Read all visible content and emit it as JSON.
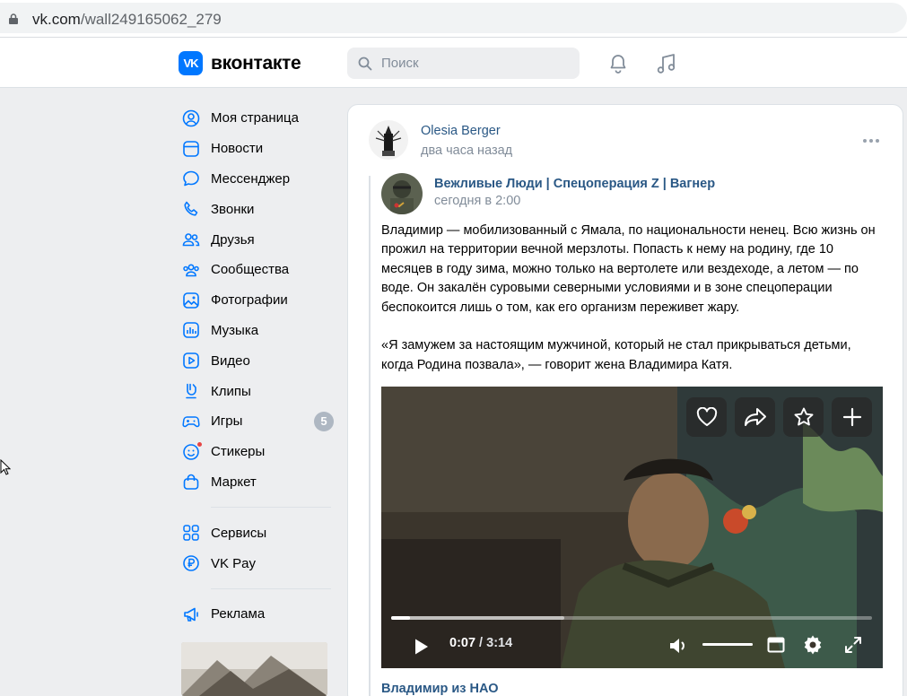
{
  "browser": {
    "url_domain": "vk.com",
    "url_path": "/wall249165062_279"
  },
  "header": {
    "logo_mark": "VK",
    "logo_text": "вконтакте",
    "search_placeholder": "Поиск"
  },
  "sidebar": {
    "items": [
      {
        "label": "Моя страница",
        "icon": "user-circle-icon"
      },
      {
        "label": "Новости",
        "icon": "news-icon"
      },
      {
        "label": "Мессенджер",
        "icon": "message-icon"
      },
      {
        "label": "Звонки",
        "icon": "phone-icon"
      },
      {
        "label": "Друзья",
        "icon": "friends-icon"
      },
      {
        "label": "Сообщества",
        "icon": "communities-icon"
      },
      {
        "label": "Фотографии",
        "icon": "photo-icon"
      },
      {
        "label": "Музыка",
        "icon": "music-icon"
      },
      {
        "label": "Видео",
        "icon": "video-icon"
      },
      {
        "label": "Клипы",
        "icon": "clips-icon"
      },
      {
        "label": "Игры",
        "icon": "gamepad-icon",
        "badge": "5"
      },
      {
        "label": "Стикеры",
        "icon": "sticker-icon"
      },
      {
        "label": "Маркет",
        "icon": "market-icon"
      }
    ],
    "secondary": [
      {
        "label": "Сервисы",
        "icon": "services-icon"
      },
      {
        "label": "VK Pay",
        "icon": "vkpay-icon"
      }
    ],
    "tertiary": [
      {
        "label": "Реклама",
        "icon": "megaphone-icon"
      }
    ]
  },
  "post": {
    "author": "Olesia Berger",
    "time": "два часа назад",
    "repost": {
      "author": "Вежливые Люди | Спецоперация Z | Вагнер",
      "time": "сегодня в 2:00",
      "text_p1": "Владимир — мобилизованный с Ямала, по национальности ненец. Всю жизнь он прожил на территории вечной мерзлоты. Попасть к нему на родину, где 10 месяцев в году зима, можно только на вертолете или вездеходе, а летом — по воде. Он закалён суровыми северными условиями и в зоне спецоперации беспокоится лишь о том, как его организм переживет жару.",
      "text_p2": "«Я замужем за настоящим мужчиной, который не стал прикрываться детьми, когда Родина позвала», — говорит жена Владимира Катя."
    },
    "video": {
      "current_time": "0:07",
      "separator": " / ",
      "duration": "3:14",
      "progress_fraction": 0.04,
      "buffered_fraction": 0.36,
      "volume_fraction": 1.0,
      "title": "Владимир из НАО"
    }
  },
  "colors": {
    "accent": "#0077ff",
    "link": "#2a5885",
    "secondary_text": "#818c99",
    "nav_icon": "#0077ff",
    "page_bg": "#edeef0"
  }
}
